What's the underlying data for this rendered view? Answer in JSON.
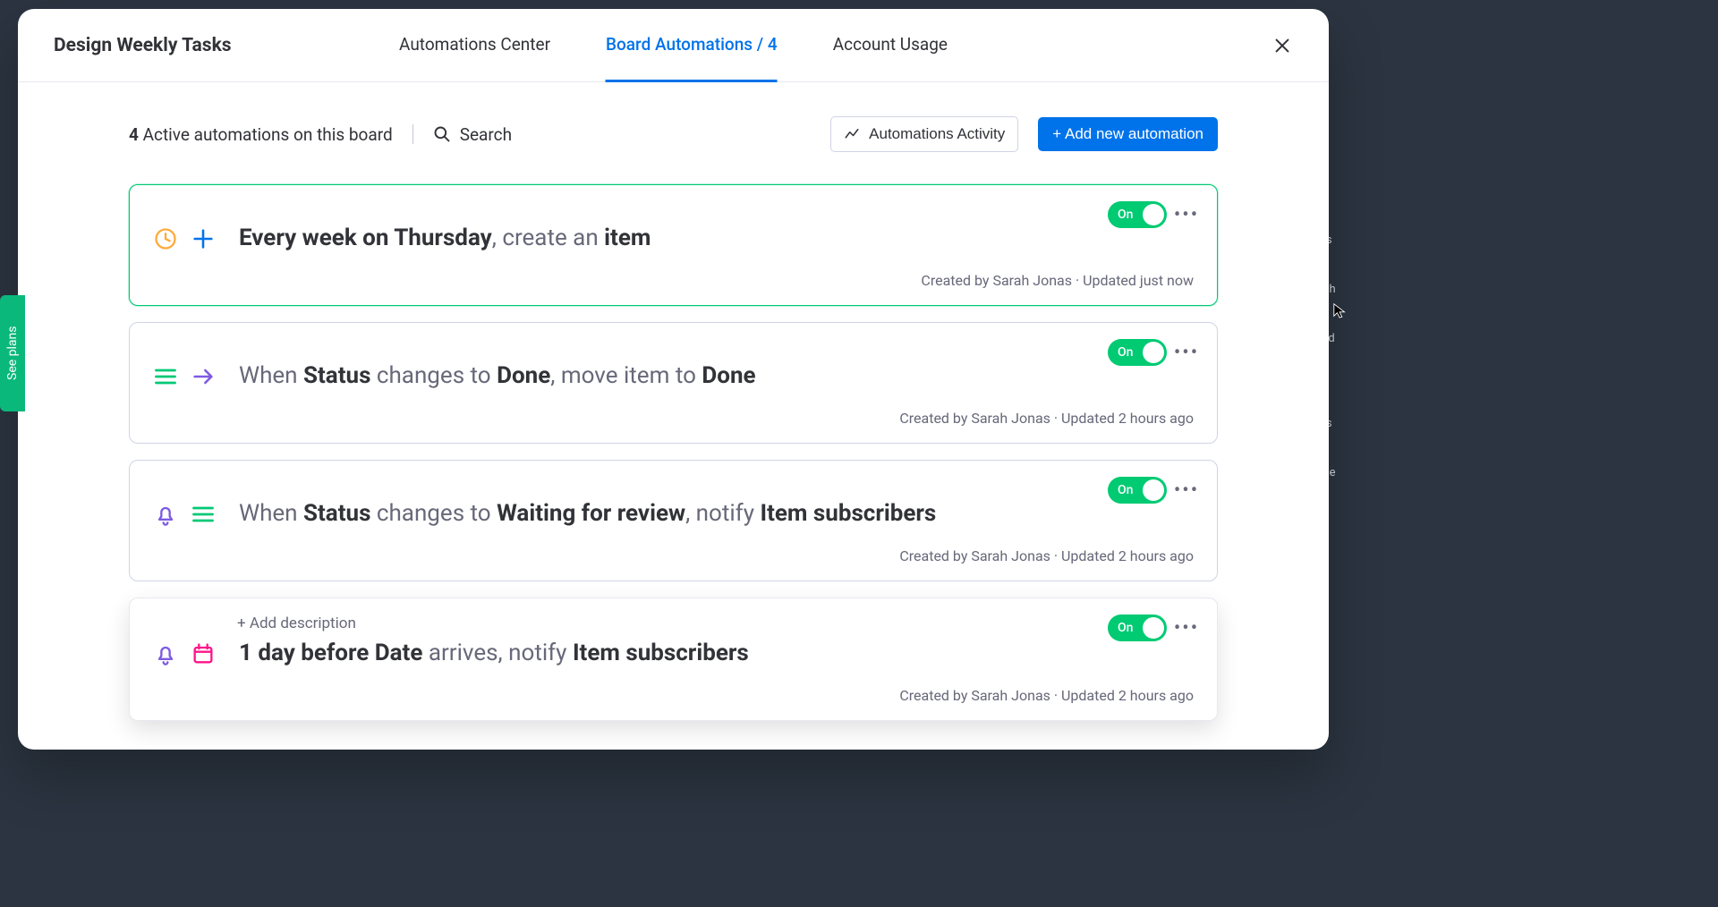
{
  "see_plans_label": "See plans",
  "header": {
    "board_title": "Design Weekly Tasks",
    "tabs": {
      "center": "Automations Center",
      "board": "Board Automations / 4",
      "usage": "Account Usage"
    }
  },
  "toolbar": {
    "count": "4",
    "count_label": " Active automations on this board",
    "search_label": "Search",
    "activity_label": "Automations Activity",
    "add_label": "+ Add new automation"
  },
  "toggle_label": "On",
  "add_description_label": "+ Add description",
  "automations": [
    {
      "recipe_html": [
        "Every week on Thursday",
        ", create an ",
        "item"
      ],
      "meta": "Created by Sarah Jonas · Updated just now"
    },
    {
      "recipe_html": [
        "When ",
        "Status",
        " changes to ",
        "Done",
        ", move item to ",
        "Done"
      ],
      "meta": "Created by Sarah Jonas · Updated 2 hours ago"
    },
    {
      "recipe_html": [
        "When ",
        "Status",
        " changes to ",
        "Waiting for review",
        ", notify ",
        "Item subscribers"
      ],
      "meta": "Created by Sarah Jonas · Updated 2 hours ago"
    },
    {
      "recipe_html": [
        "1 day before ",
        "Date",
        " arrives, notify ",
        "Item subscribers"
      ],
      "meta": "Created by Sarah Jonas · Updated 2 hours ago"
    }
  ]
}
